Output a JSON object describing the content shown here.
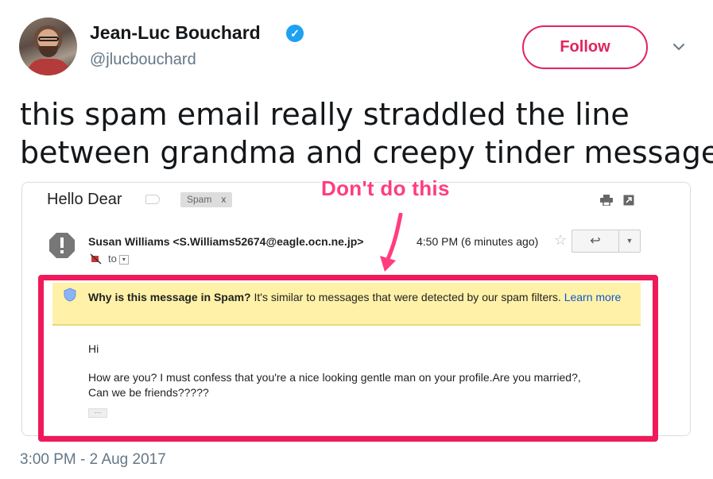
{
  "author": {
    "name": "Jean-Luc Bouchard",
    "handle": "@jlucbouchard",
    "verified_mark": "✓"
  },
  "follow_label": "Follow",
  "tweet": {
    "lines": [
      "this spam email really straddled the line",
      "between grandma and creepy tinder message"
    ],
    "timestamp": "3:00 PM - 2 Aug 2017"
  },
  "annotation": {
    "text": "Don't do this",
    "color": "#ff3d7f"
  },
  "email": {
    "subject": "Hello Dear",
    "label": "Spam",
    "label_close": "x",
    "sender": "Susan Williams <S.Williams52674@eagle.ocn.ne.jp>",
    "to_label": "to",
    "time": "4:50 PM (6 minutes ago)",
    "star": "☆",
    "reply": "↩",
    "more": "▼",
    "banner": {
      "heading": "Why is this message in Spam?",
      "text": " It's similar to messages that were detected by our spam filters. ",
      "link": "Learn more"
    },
    "greeting": "Hi",
    "body_line1": "How are you? I must confess that you're a nice looking gentle man on your profile.Are you married?,",
    "body_line2": "Can we be friends?????",
    "ellipsis": "···"
  },
  "colors": {
    "accent": "#e0245e",
    "verified": "#1da1f2",
    "highlight": "#f0195a",
    "banner": "#fff1a8"
  }
}
